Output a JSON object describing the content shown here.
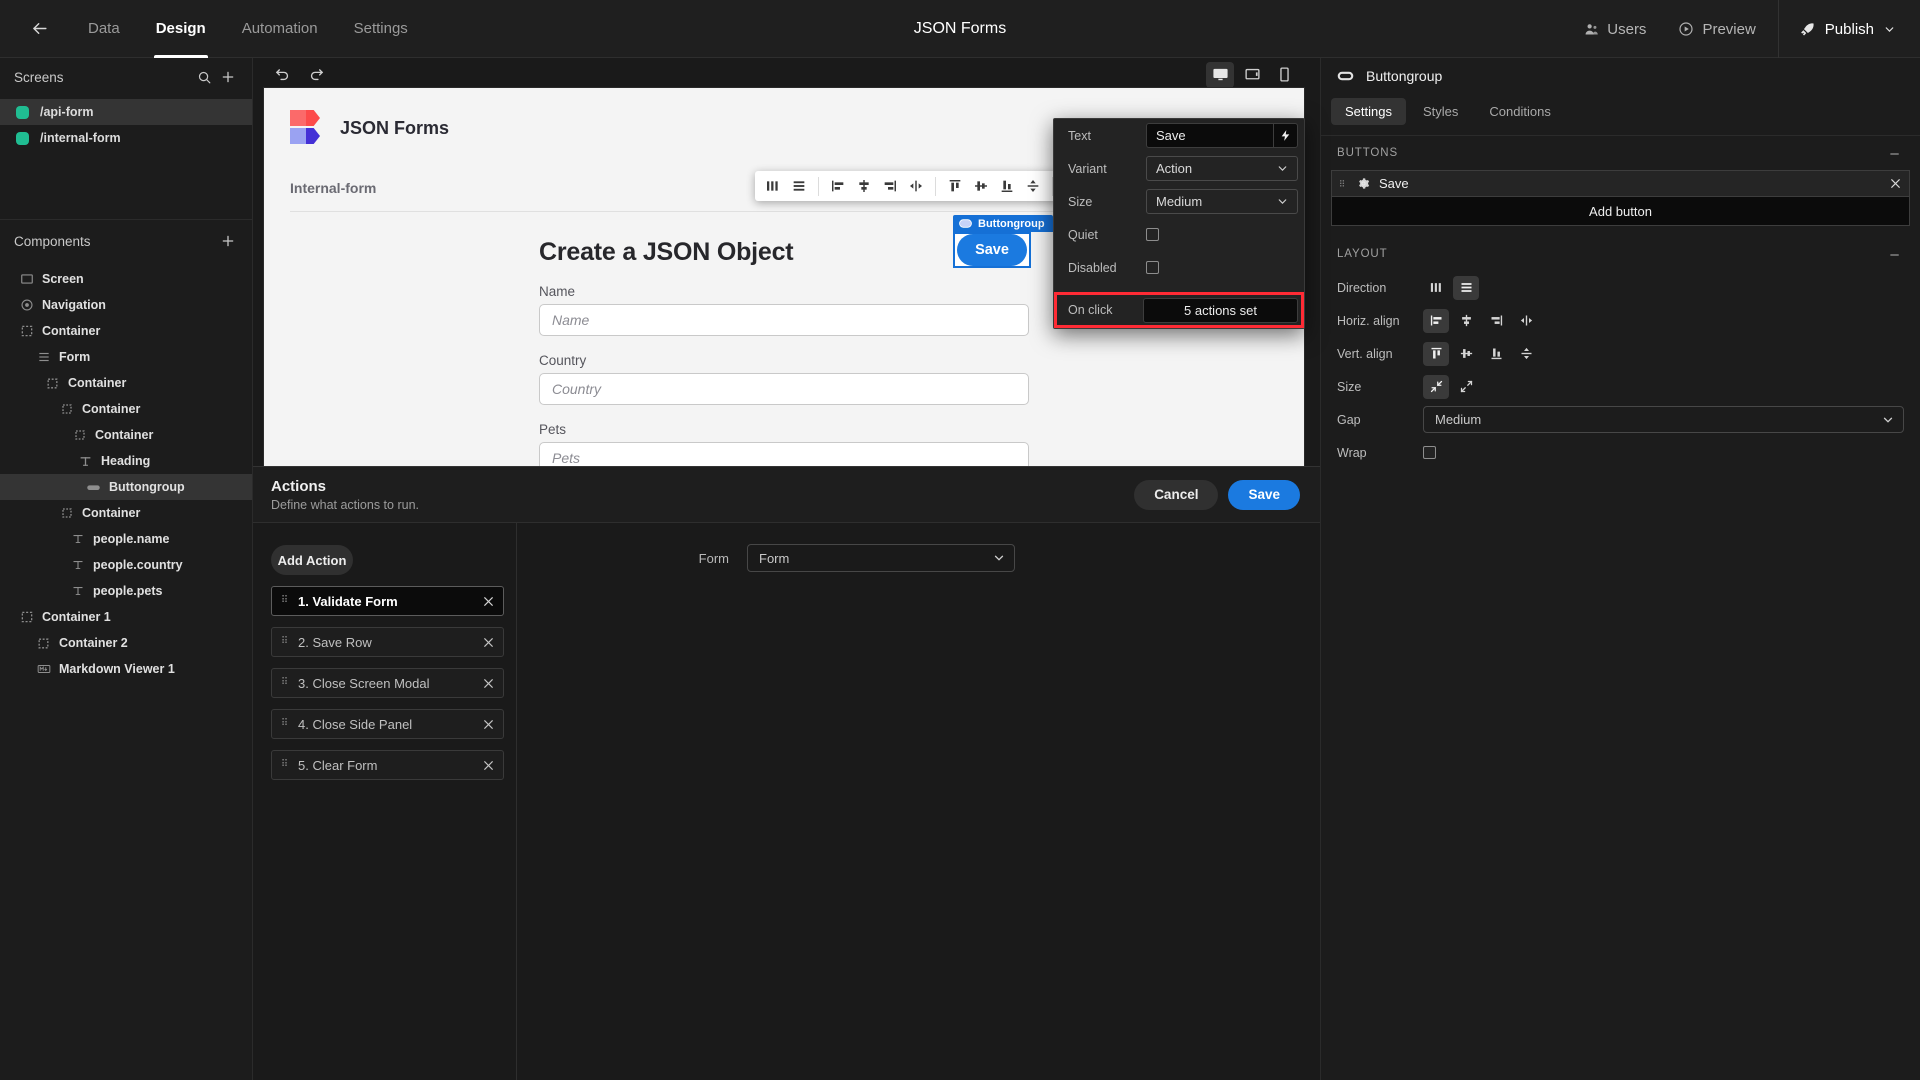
{
  "topbar": {
    "back_icon": "arrow-left-icon",
    "tabs": [
      {
        "label": "Data",
        "active": false
      },
      {
        "label": "Design",
        "active": true
      },
      {
        "label": "Automation",
        "active": false
      },
      {
        "label": "Settings",
        "active": false
      }
    ],
    "title": "JSON Forms",
    "users_label": "Users",
    "preview_label": "Preview",
    "publish_label": "Publish"
  },
  "left_panel": {
    "screens_title": "Screens",
    "screens": [
      {
        "label": "/api-form",
        "color": "#20bd92",
        "active": true
      },
      {
        "label": "/internal-form",
        "color": "#20bd92",
        "active": false
      }
    ],
    "components_title": "Components",
    "tree": [
      {
        "label": "Screen",
        "icon": "screen-icon",
        "depth": 0,
        "selected": false
      },
      {
        "label": "Navigation",
        "icon": "navigation-icon",
        "depth": 0,
        "selected": false
      },
      {
        "label": "Container",
        "icon": "container-icon",
        "depth": 0,
        "selected": false
      },
      {
        "label": "Form",
        "icon": "form-icon",
        "depth": 1,
        "selected": false
      },
      {
        "label": "Container",
        "icon": "container-icon",
        "depth": 2,
        "selected": false
      },
      {
        "label": "Container",
        "icon": "container-icon",
        "depth": 3,
        "selected": false
      },
      {
        "label": "Container",
        "icon": "container-icon",
        "depth": 4,
        "selected": false
      },
      {
        "label": "Heading",
        "icon": "text-icon",
        "depth": 5,
        "selected": false
      },
      {
        "label": "Buttongroup",
        "icon": "buttongroup-icon",
        "depth": 6,
        "selected": true
      },
      {
        "label": "Container",
        "icon": "container-icon",
        "depth": 3,
        "selected": false
      },
      {
        "label": "people.name",
        "icon": "text-icon",
        "depth": 4,
        "selected": false
      },
      {
        "label": "people.country",
        "icon": "text-icon",
        "depth": 4,
        "selected": false
      },
      {
        "label": "people.pets",
        "icon": "text-icon",
        "depth": 4,
        "selected": false
      },
      {
        "label": "Container 1",
        "icon": "container-icon",
        "depth": 0,
        "selected": false
      },
      {
        "label": "Container 2",
        "icon": "container-icon",
        "depth": 1,
        "selected": false
      },
      {
        "label": "Markdown Viewer 1",
        "icon": "markdown-icon",
        "depth": 2,
        "selected": false
      }
    ]
  },
  "canvas_bar": {
    "undo_icon": "undo-icon",
    "redo_icon": "redo-icon",
    "devices": [
      {
        "name": "desktop-icon",
        "active": true
      },
      {
        "name": "tablet-icon",
        "active": false
      },
      {
        "name": "mobile-icon",
        "active": false
      }
    ]
  },
  "canvas": {
    "app_name": "JSON Forms",
    "breadcrumb": "Internal-form",
    "form_title": "Create a JSON Object",
    "fields": [
      {
        "label": "Name",
        "placeholder": "Name",
        "value": ""
      },
      {
        "label": "Country",
        "placeholder": "Country",
        "value": ""
      },
      {
        "label": "Pets",
        "placeholder": "Pets",
        "value": ""
      }
    ],
    "selection_tag": "Buttongroup",
    "selected_button_label": "Save",
    "align_toolbar_icons": [
      "direction-horizontal-icon",
      "direction-vertical-icon",
      "align-left-icon",
      "align-center-icon",
      "align-right-icon",
      "align-space-between-icon",
      "valign-top-icon",
      "valign-middle-icon",
      "valign-bottom-icon",
      "valign-stretch-icon",
      "size-shrink-icon"
    ]
  },
  "popover": {
    "text_label": "Text",
    "text_value": "Save",
    "bind_icon": "lightning-icon",
    "variant_label": "Variant",
    "variant_value": "Action",
    "size_label": "Size",
    "size_value": "Medium",
    "quiet_label": "Quiet",
    "quiet_checked": false,
    "disabled_label": "Disabled",
    "disabled_checked": false,
    "onclick_label": "On click",
    "onclick_value": "5 actions set",
    "highlight_color": "#ff2b35"
  },
  "drawer": {
    "title": "Actions",
    "subtitle": "Define what actions to run.",
    "cancel_label": "Cancel",
    "save_label": "Save",
    "add_action_label": "Add Action",
    "actions": [
      {
        "label": "1. Validate Form",
        "selected": true
      },
      {
        "label": "2. Save Row",
        "selected": false
      },
      {
        "label": "3. Close Screen Modal",
        "selected": false
      },
      {
        "label": "4. Close Side Panel",
        "selected": false
      },
      {
        "label": "5. Clear Form",
        "selected": false
      }
    ],
    "detail": {
      "form_label": "Form",
      "form_value": "Form"
    }
  },
  "right_panel": {
    "component_icon": "buttongroup-icon",
    "component_name": "Buttongroup",
    "tabs": [
      {
        "label": "Settings",
        "active": true
      },
      {
        "label": "Styles",
        "active": false
      },
      {
        "label": "Conditions",
        "active": false
      }
    ],
    "buttons_section": {
      "title": "BUTTONS",
      "items": [
        {
          "label": "Save"
        }
      ],
      "add_label": "Add button"
    },
    "layout_section": {
      "title": "LAYOUT",
      "direction_label": "Direction",
      "direction_options": [
        "direction-horizontal-icon",
        "direction-vertical-icon"
      ],
      "direction_active": 1,
      "halign_label": "Horiz. align",
      "halign_options": [
        "align-left-icon",
        "align-center-icon",
        "align-right-icon",
        "align-space-between-icon"
      ],
      "halign_active": 0,
      "valign_label": "Vert. align",
      "valign_options": [
        "valign-top-icon",
        "valign-middle-icon",
        "valign-bottom-icon",
        "valign-stretch-icon"
      ],
      "valign_active": 0,
      "size_label": "Size",
      "size_options": [
        "size-shrink-icon",
        "size-grow-icon"
      ],
      "size_active": 0,
      "gap_label": "Gap",
      "gap_value": "Medium",
      "wrap_label": "Wrap",
      "wrap_checked": false
    }
  }
}
